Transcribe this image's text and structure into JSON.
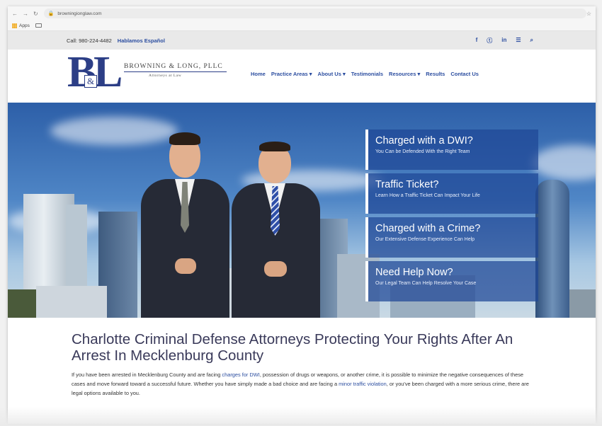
{
  "browser": {
    "url": "browningionglaw.com",
    "bookmarks": [
      "Apps"
    ]
  },
  "topbar": {
    "call": "Call: 980-224-4482",
    "espanol": "Hablamos Español",
    "social_icons": [
      "facebook-icon",
      "twitter-icon",
      "linkedin-icon",
      "rss-icon",
      "search-icon"
    ],
    "social_glyphs": [
      "f",
      "ⓣ",
      "in",
      "☰",
      "⌕"
    ]
  },
  "logo": {
    "b": "B",
    "l": "L",
    "amp": "&",
    "name": "BROWNING & LONG, PLLC",
    "sub": "Attorneys at Law"
  },
  "nav": {
    "items": [
      "Home",
      "Practice Areas ▾",
      "About Us ▾",
      "Testimonials",
      "Resources ▾",
      "Results",
      "Contact Us"
    ]
  },
  "hero": {
    "ctas": [
      {
        "title": "Charged with a DWI?",
        "subtitle": "You Can be Defended With the Right Team"
      },
      {
        "title": "Traffic Ticket?",
        "subtitle": "Learn How a Traffic Ticket Can Impact Your Life"
      },
      {
        "title": "Charged with a Crime?",
        "subtitle": "Our Extensive Defense Experience Can Help"
      },
      {
        "title": "Need Help Now?",
        "subtitle": "Our Legal Team Can Help Resolve Your Case"
      }
    ]
  },
  "content": {
    "headline": "Charlotte Criminal Defense Attorneys Protecting Your Rights After An Arrest In Mecklenburg County",
    "p1": "If you have been arrested in Mecklenburg County and are facing ",
    "link1": "charges for DWI",
    "p2": ", possession of drugs or weapons, or another crime, it is possible to minimize the negative consequences of these cases and move forward toward a successful future. Whether you have simply made a bad choice and are facing a ",
    "link2": "minor traffic violation",
    "p3": ", or you've been charged with a more serious crime, there are legal options available to you."
  },
  "colors": {
    "brand_blue": "#2c4ea0",
    "logo_navy": "#2c3e86",
    "cta_bg": "#1e4696",
    "heading": "#3a3a5a"
  }
}
